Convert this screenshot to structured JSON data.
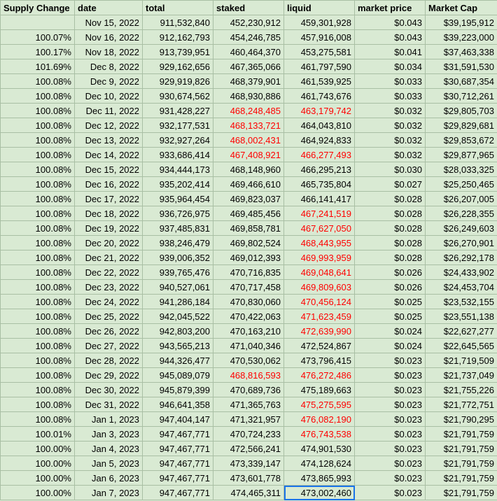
{
  "colors": {
    "cell_background": "#d9ead3",
    "gridline": "#a9bfa4",
    "highlight_text": "#ff0000",
    "selection_border": "#1a73e8"
  },
  "headers": [
    "Supply Change",
    "date",
    "total",
    "staked",
    "liquid",
    "market price",
    "Market Cap"
  ],
  "rows": [
    {
      "change": "",
      "date": "Nov 15, 2022",
      "total": "911,532,840",
      "staked": "452,230,912",
      "liquid": "459,301,928",
      "price": "$0.043",
      "cap": "$39,195,912"
    },
    {
      "change": "100.07%",
      "date": "Nov 16, 2022",
      "total": "912,162,793",
      "staked": "454,246,785",
      "liquid": "457,916,008",
      "price": "$0.043",
      "cap": "$39,223,000"
    },
    {
      "change": "100.17%",
      "date": "Nov 18, 2022",
      "total": "913,739,951",
      "staked": "460,464,370",
      "liquid": "453,275,581",
      "price": "$0.041",
      "cap": "$37,463,338"
    },
    {
      "change": "101.69%",
      "date": "Dec 8, 2022",
      "total": "929,162,656",
      "staked": "467,365,066",
      "liquid": "461,797,590",
      "price": "$0.034",
      "cap": "$31,591,530"
    },
    {
      "change": "100.08%",
      "date": "Dec 9, 2022",
      "total": "929,919,826",
      "staked": "468,379,901",
      "liquid": "461,539,925",
      "price": "$0.033",
      "cap": "$30,687,354"
    },
    {
      "change": "100.08%",
      "date": "Dec 10, 2022",
      "total": "930,674,562",
      "staked": "468,930,886",
      "liquid": "461,743,676",
      "price": "$0.033",
      "cap": "$30,712,261"
    },
    {
      "change": "100.08%",
      "date": "Dec 11, 2022",
      "total": "931,428,227",
      "staked": "468,248,485",
      "liquid": "463,179,742",
      "price": "$0.032",
      "cap": "$29,805,703",
      "red": [
        "staked",
        "liquid"
      ]
    },
    {
      "change": "100.08%",
      "date": "Dec 12, 2022",
      "total": "932,177,531",
      "staked": "468,133,721",
      "liquid": "464,043,810",
      "price": "$0.032",
      "cap": "$29,829,681",
      "red": [
        "staked"
      ]
    },
    {
      "change": "100.08%",
      "date": "Dec 13, 2022",
      "total": "932,927,264",
      "staked": "468,002,431",
      "liquid": "464,924,833",
      "price": "$0.032",
      "cap": "$29,853,672",
      "red": [
        "staked"
      ]
    },
    {
      "change": "100.08%",
      "date": "Dec 14, 2022",
      "total": "933,686,414",
      "staked": "467,408,921",
      "liquid": "466,277,493",
      "price": "$0.032",
      "cap": "$29,877,965",
      "red": [
        "staked",
        "liquid"
      ]
    },
    {
      "change": "100.08%",
      "date": "Dec 15, 2022",
      "total": "934,444,173",
      "staked": "468,148,960",
      "liquid": "466,295,213",
      "price": "$0.030",
      "cap": "$28,033,325"
    },
    {
      "change": "100.08%",
      "date": "Dec 16, 2022",
      "total": "935,202,414",
      "staked": "469,466,610",
      "liquid": "465,735,804",
      "price": "$0.027",
      "cap": "$25,250,465"
    },
    {
      "change": "100.08%",
      "date": "Dec 17, 2022",
      "total": "935,964,454",
      "staked": "469,823,037",
      "liquid": "466,141,417",
      "price": "$0.028",
      "cap": "$26,207,005"
    },
    {
      "change": "100.08%",
      "date": "Dec 18, 2022",
      "total": "936,726,975",
      "staked": "469,485,456",
      "liquid": "467,241,519",
      "price": "$0.028",
      "cap": "$26,228,355",
      "red": [
        "liquid"
      ]
    },
    {
      "change": "100.08%",
      "date": "Dec 19, 2022",
      "total": "937,485,831",
      "staked": "469,858,781",
      "liquid": "467,627,050",
      "price": "$0.028",
      "cap": "$26,249,603",
      "red": [
        "liquid"
      ]
    },
    {
      "change": "100.08%",
      "date": "Dec 20, 2022",
      "total": "938,246,479",
      "staked": "469,802,524",
      "liquid": "468,443,955",
      "price": "$0.028",
      "cap": "$26,270,901",
      "red": [
        "liquid"
      ]
    },
    {
      "change": "100.08%",
      "date": "Dec 21, 2022",
      "total": "939,006,352",
      "staked": "469,012,393",
      "liquid": "469,993,959",
      "price": "$0.028",
      "cap": "$26,292,178",
      "red": [
        "liquid"
      ]
    },
    {
      "change": "100.08%",
      "date": "Dec 22, 2022",
      "total": "939,765,476",
      "staked": "470,716,835",
      "liquid": "469,048,641",
      "price": "$0.026",
      "cap": "$24,433,902",
      "red": [
        "liquid"
      ]
    },
    {
      "change": "100.08%",
      "date": "Dec 23, 2022",
      "total": "940,527,061",
      "staked": "470,717,458",
      "liquid": "469,809,603",
      "price": "$0.026",
      "cap": "$24,453,704",
      "red": [
        "liquid"
      ]
    },
    {
      "change": "100.08%",
      "date": "Dec 24, 2022",
      "total": "941,286,184",
      "staked": "470,830,060",
      "liquid": "470,456,124",
      "price": "$0.025",
      "cap": "$23,532,155",
      "red": [
        "liquid"
      ]
    },
    {
      "change": "100.08%",
      "date": "Dec 25, 2022",
      "total": "942,045,522",
      "staked": "470,422,063",
      "liquid": "471,623,459",
      "price": "$0.025",
      "cap": "$23,551,138",
      "red": [
        "liquid"
      ]
    },
    {
      "change": "100.08%",
      "date": "Dec 26, 2022",
      "total": "942,803,200",
      "staked": "470,163,210",
      "liquid": "472,639,990",
      "price": "$0.024",
      "cap": "$22,627,277",
      "red": [
        "liquid"
      ]
    },
    {
      "change": "100.08%",
      "date": "Dec 27, 2022",
      "total": "943,565,213",
      "staked": "471,040,346",
      "liquid": "472,524,867",
      "price": "$0.024",
      "cap": "$22,645,565"
    },
    {
      "change": "100.08%",
      "date": "Dec 28, 2022",
      "total": "944,326,477",
      "staked": "470,530,062",
      "liquid": "473,796,415",
      "price": "$0.023",
      "cap": "$21,719,509"
    },
    {
      "change": "100.08%",
      "date": "Dec 29, 2022",
      "total": "945,089,079",
      "staked": "468,816,593",
      "liquid": "476,272,486",
      "price": "$0.023",
      "cap": "$21,737,049",
      "red": [
        "staked",
        "liquid"
      ]
    },
    {
      "change": "100.08%",
      "date": "Dec 30, 2022",
      "total": "945,879,399",
      "staked": "470,689,736",
      "liquid": "475,189,663",
      "price": "$0.023",
      "cap": "$21,755,226"
    },
    {
      "change": "100.08%",
      "date": "Dec 31, 2022",
      "total": "946,641,358",
      "staked": "471,365,763",
      "liquid": "475,275,595",
      "price": "$0.023",
      "cap": "$21,772,751",
      "red": [
        "liquid"
      ]
    },
    {
      "change": "100.08%",
      "date": "Jan 1, 2023",
      "total": "947,404,147",
      "staked": "471,321,957",
      "liquid": "476,082,190",
      "price": "$0.023",
      "cap": "$21,790,295",
      "red": [
        "liquid"
      ]
    },
    {
      "change": "100.01%",
      "date": "Jan 3, 2023",
      "total": "947,467,771",
      "staked": "470,724,233",
      "liquid": "476,743,538",
      "price": "$0.023",
      "cap": "$21,791,759",
      "red": [
        "liquid"
      ]
    },
    {
      "change": "100.00%",
      "date": "Jan 4, 2023",
      "total": "947,467,771",
      "staked": "472,566,241",
      "liquid": "474,901,530",
      "price": "$0.023",
      "cap": "$21,791,759"
    },
    {
      "change": "100.00%",
      "date": "Jan 5, 2023",
      "total": "947,467,771",
      "staked": "473,339,147",
      "liquid": "474,128,624",
      "price": "$0.023",
      "cap": "$21,791,759"
    },
    {
      "change": "100.00%",
      "date": "Jan 6, 2023",
      "total": "947,467,771",
      "staked": "473,601,778",
      "liquid": "473,865,993",
      "price": "$0.023",
      "cap": "$21,791,759"
    },
    {
      "change": "100.00%",
      "date": "Jan 7, 2023",
      "total": "947,467,771",
      "staked": "474,465,311",
      "liquid": "473,002,460",
      "price": "$0.023",
      "cap": "$21,791,759",
      "selected": "liquid"
    }
  ]
}
